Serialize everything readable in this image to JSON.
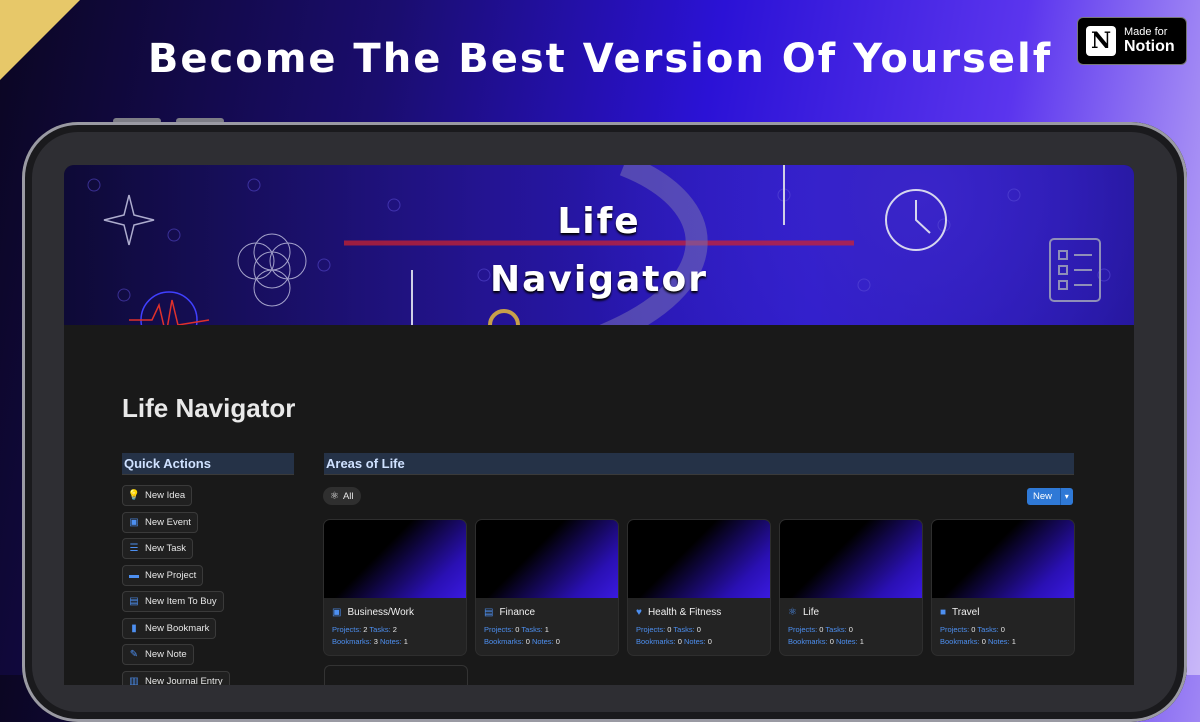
{
  "headline": "Become The Best Version Of Yourself",
  "badge": {
    "line1": "Made for",
    "line2": "Notion",
    "logo_letter": "N"
  },
  "banner": {
    "title_line1": "Life",
    "title_line2": "Navigator"
  },
  "page_title": "Life Navigator",
  "quick_actions": {
    "header": "Quick Actions",
    "items": [
      {
        "label": "New Idea",
        "icon": "lightbulb-icon",
        "glyph": "💡"
      },
      {
        "label": "New Event",
        "icon": "ticket-icon",
        "glyph": "▣"
      },
      {
        "label": "New Task",
        "icon": "checklist-icon",
        "glyph": "☰"
      },
      {
        "label": "New Project",
        "icon": "folder-icon",
        "glyph": "▬"
      },
      {
        "label": "New Item To Buy",
        "icon": "cart-icon",
        "glyph": "▤"
      },
      {
        "label": "New Bookmark",
        "icon": "bookmark-icon",
        "glyph": "▮"
      },
      {
        "label": "New Note",
        "icon": "pencil-icon",
        "glyph": "✎"
      },
      {
        "label": "New Journal Entry",
        "icon": "journal-icon",
        "glyph": "▥"
      }
    ]
  },
  "areas": {
    "header": "Areas of Life",
    "filter_all": "All",
    "new_label": "New",
    "cards": [
      {
        "name": "Business/Work",
        "icon": "briefcase-icon",
        "glyph": "▣",
        "projects": "2",
        "tasks": "2",
        "bookmarks": "3",
        "notes": "1"
      },
      {
        "name": "Finance",
        "icon": "money-icon",
        "glyph": "▤",
        "projects": "0",
        "tasks": "1",
        "bookmarks": "0",
        "notes": "0"
      },
      {
        "name": "Health & Fitness",
        "icon": "heart-pulse-icon",
        "glyph": "♥",
        "projects": "0",
        "tasks": "0",
        "bookmarks": "0",
        "notes": "0"
      },
      {
        "name": "Life",
        "icon": "atom-icon",
        "glyph": "⚛",
        "projects": "0",
        "tasks": "0",
        "bookmarks": "0",
        "notes": "1"
      },
      {
        "name": "Travel",
        "icon": "camera-icon",
        "glyph": "■",
        "projects": "0",
        "tasks": "0",
        "bookmarks": "0",
        "notes": "1"
      }
    ],
    "labels": {
      "projects": "Projects:",
      "tasks": "Tasks:",
      "bookmarks": "Bookmarks:",
      "notes": "Notes:"
    }
  },
  "colors": {
    "accent": "#2f79d6",
    "gold": "#e7c869",
    "header_bg": "#253247"
  }
}
